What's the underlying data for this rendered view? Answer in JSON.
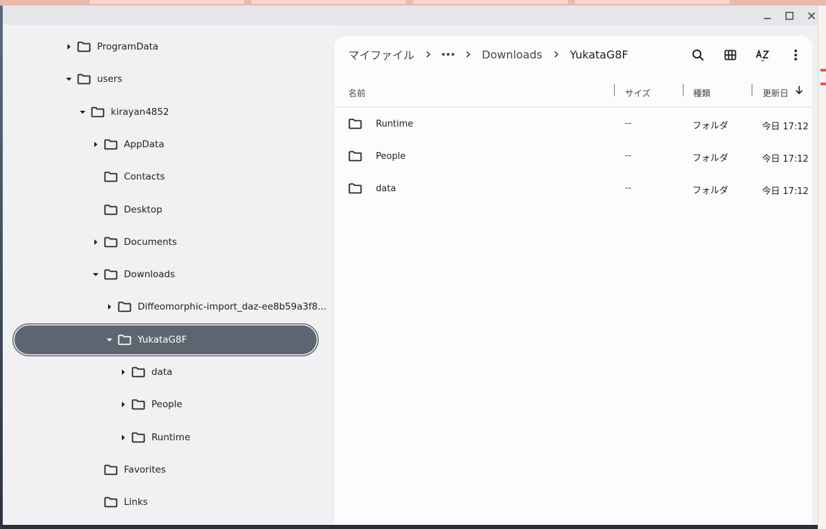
{
  "window": {
    "controls": {
      "minimize_icon": "minimize-icon",
      "maximize_icon": "maximize-icon",
      "close_icon": "close-icon"
    }
  },
  "sidebar": {
    "items": [
      {
        "label": "ProgramData",
        "level": 0,
        "expander": "collapsed"
      },
      {
        "label": "users",
        "level": 0,
        "expander": "expanded"
      },
      {
        "label": "kirayan4852",
        "level": 1,
        "expander": "expanded"
      },
      {
        "label": "AppData",
        "level": 2,
        "expander": "collapsed"
      },
      {
        "label": "Contacts",
        "level": 2,
        "expander": "none"
      },
      {
        "label": "Desktop",
        "level": 2,
        "expander": "none"
      },
      {
        "label": "Documents",
        "level": 2,
        "expander": "collapsed"
      },
      {
        "label": "Downloads",
        "level": 2,
        "expander": "expanded"
      },
      {
        "label": "Diffeomorphic-import_daz-ee8b59a3f8...",
        "level": 3,
        "expander": "collapsed"
      },
      {
        "label": "YukataG8F",
        "level": 3,
        "expander": "expanded",
        "selected": true
      },
      {
        "label": "data",
        "level": 4,
        "expander": "collapsed"
      },
      {
        "label": "People",
        "level": 4,
        "expander": "collapsed"
      },
      {
        "label": "Runtime",
        "level": 4,
        "expander": "collapsed"
      },
      {
        "label": "Favorites",
        "level": 2,
        "expander": "none"
      },
      {
        "label": "Links",
        "level": 2,
        "expander": "none"
      }
    ]
  },
  "breadcrumb": {
    "root": "マイファイル",
    "overflow_icon": "more-horizontal-icon",
    "parent": "Downloads",
    "current": "YukataG8F"
  },
  "toolbar": {
    "search_icon": "search-icon",
    "grid_view_icon": "grid-view-icon",
    "sort_icon": "sort-az-icon",
    "more_icon": "more-vertical-icon"
  },
  "columns": {
    "name": "名前",
    "size": "サイズ",
    "type": "種類",
    "modified": "更新日",
    "sort_direction_icon": "arrow-down-icon"
  },
  "files": [
    {
      "name": "Runtime",
      "size": "--",
      "type": "フォルダ",
      "modified": "今日 17:12"
    },
    {
      "name": "People",
      "size": "--",
      "type": "フォルダ",
      "modified": "今日 17:12"
    },
    {
      "name": "data",
      "size": "--",
      "type": "フォルダ",
      "modified": "今日 17:12"
    }
  ],
  "colors": {
    "selected_bg": "#5d6670",
    "sidebar_bg": "#f1f0f2",
    "content_bg": "#fcfbfd"
  }
}
